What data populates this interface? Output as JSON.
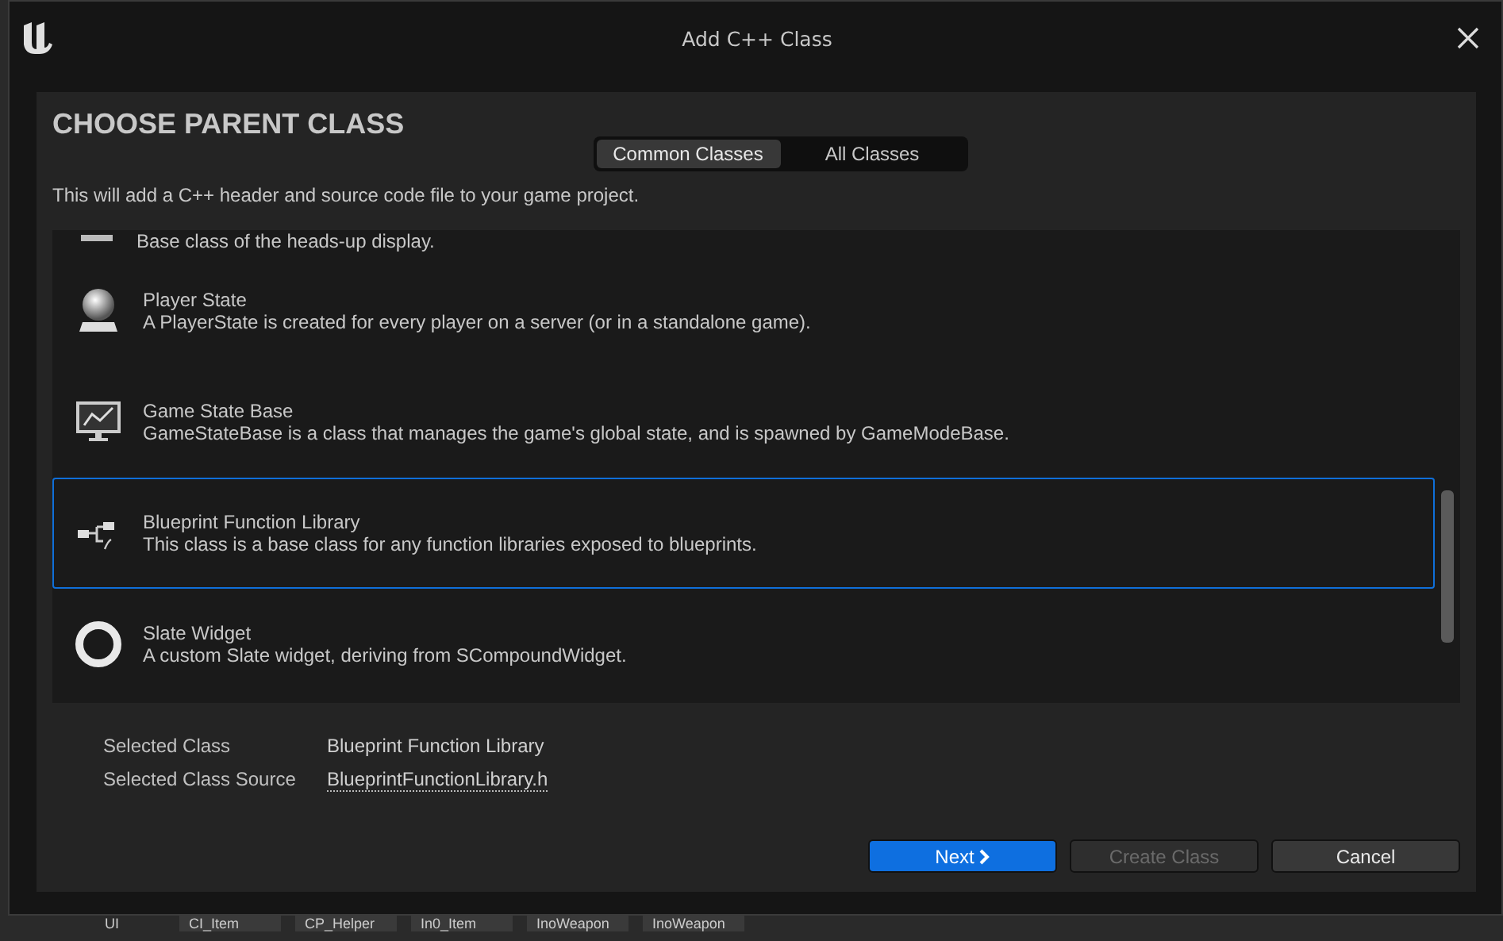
{
  "window": {
    "title": "Add C++ Class"
  },
  "heading": "CHOOSE PARENT CLASS",
  "tabs": [
    {
      "label": "Common Classes",
      "selected": true
    },
    {
      "label": "All Classes",
      "selected": false
    }
  ],
  "intro": "This will add a C++ header and source code file to your game project.",
  "partial_row": {
    "description": "Base class of the heads-up display."
  },
  "classes": [
    {
      "kind": "sphere",
      "name": "Player State",
      "description": "A PlayerState is created for every player on a server (or in a standalone game).",
      "selected": false
    },
    {
      "kind": "monitor",
      "name": "Game State Base",
      "description": "GameStateBase is a class that manages the game's global state, and is spawned by GameModeBase.",
      "selected": false
    },
    {
      "kind": "nodes",
      "name": "Blueprint Function Library",
      "description": "This class is a base class for any function libraries exposed to blueprints.",
      "selected": true
    },
    {
      "kind": "ring",
      "name": "Slate Widget",
      "description": "A custom Slate widget, deriving from SCompoundWidget.",
      "selected": false
    }
  ],
  "summary": [
    {
      "label": "Selected Class",
      "value": "Blueprint Function Library",
      "link": false
    },
    {
      "label": "Selected Class Source",
      "value": "BlueprintFunctionLibrary.h",
      "link": true
    }
  ],
  "buttons": [
    {
      "label": "Next",
      "kind": "primary",
      "disabled": false
    },
    {
      "label": "Create Class",
      "kind": "normal",
      "disabled": true
    },
    {
      "label": "Cancel",
      "kind": "normal",
      "disabled": false
    }
  ],
  "background_tabs": [
    "UI",
    "CI_Item",
    "CP_Helper",
    "In0_Item",
    "InoWeapon",
    "InoWeapon"
  ]
}
